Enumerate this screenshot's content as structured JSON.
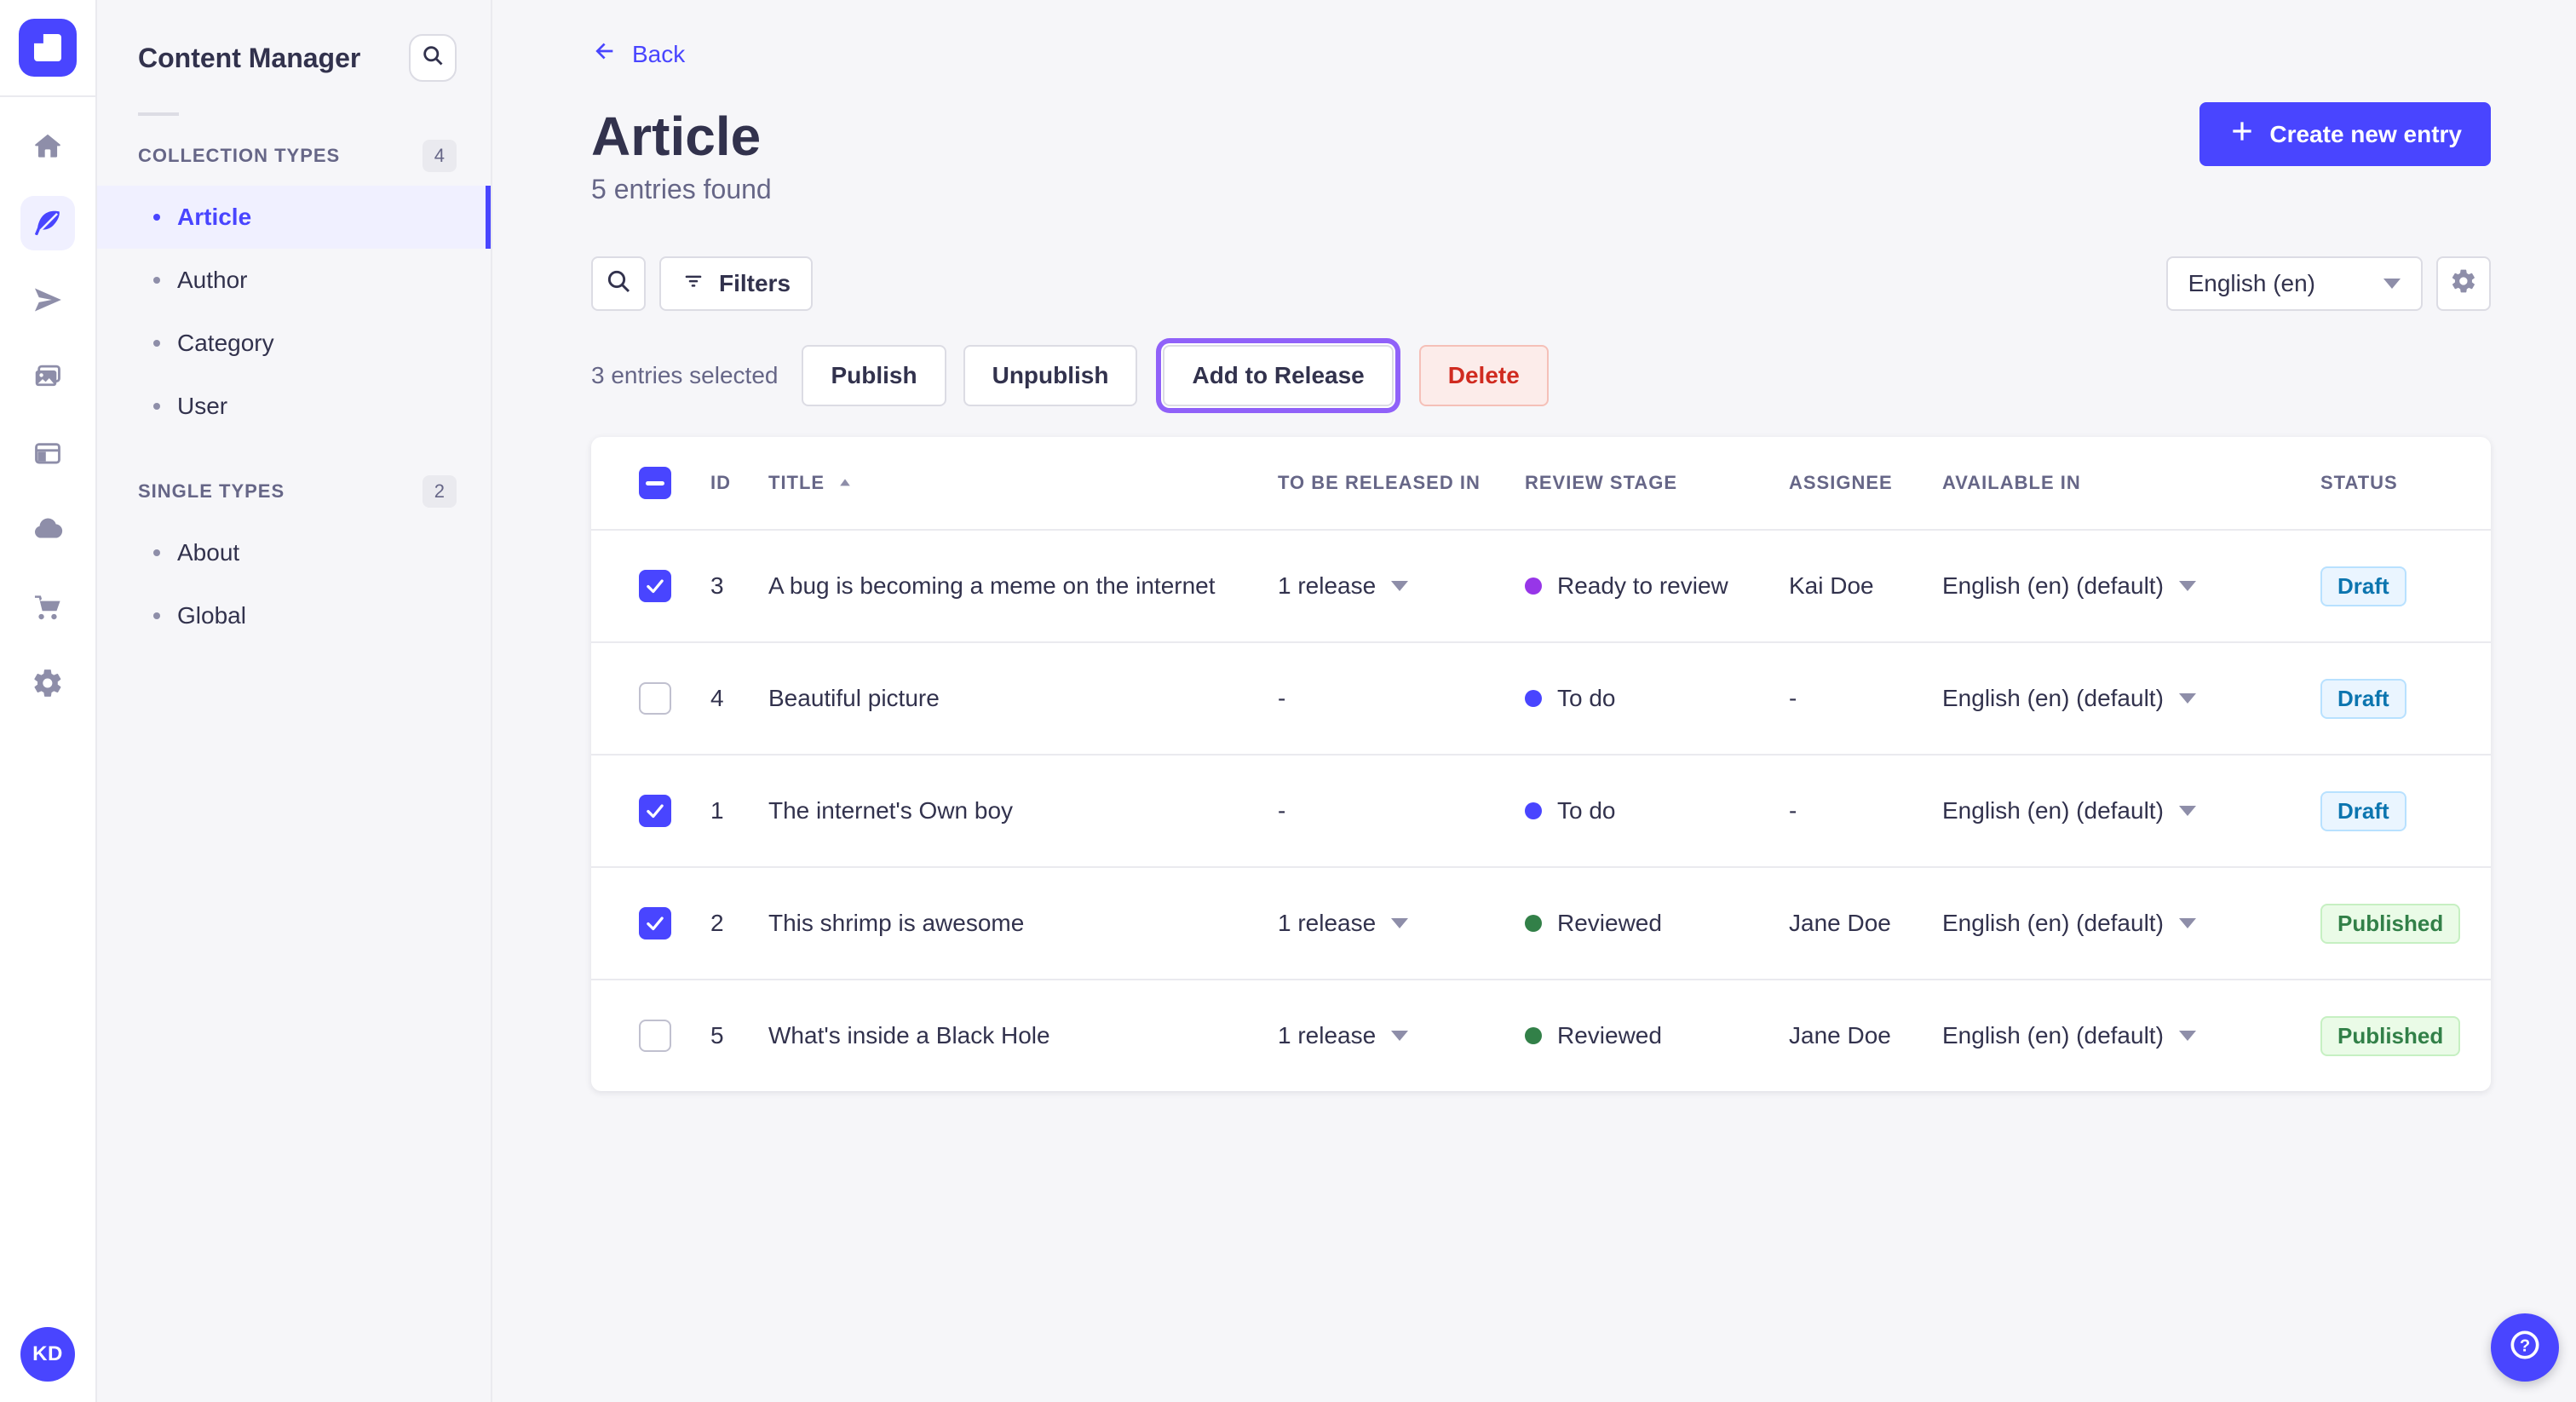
{
  "colors": {
    "primary": "#4945ff",
    "primary_light_bg": "#f0f0ff",
    "focus_ring": "#9061f9",
    "danger_text": "#d02b20",
    "danger_bg": "#fcecea",
    "danger_border": "#f5c0b8",
    "draft_bg": "#eaf5ff",
    "draft_border": "#b8e1ff",
    "draft_text": "#0c75af",
    "published_bg": "#eafbe7",
    "published_border": "#c6f0c2",
    "published_text": "#328048"
  },
  "rail": {
    "icons": [
      {
        "name": "home",
        "active": false
      },
      {
        "name": "content-manager",
        "active": true
      },
      {
        "name": "releases",
        "active": false
      },
      {
        "name": "media-library",
        "active": false
      },
      {
        "name": "content-type-builder",
        "active": false
      },
      {
        "name": "cloud",
        "active": false
      },
      {
        "name": "marketplace",
        "active": false
      },
      {
        "name": "settings",
        "active": false
      }
    ],
    "avatar_initials": "KD"
  },
  "sidebar": {
    "title": "Content Manager",
    "sections": [
      {
        "label": "COLLECTION TYPES",
        "count": "4",
        "items": [
          {
            "label": "Article",
            "active": true
          },
          {
            "label": "Author",
            "active": false
          },
          {
            "label": "Category",
            "active": false
          },
          {
            "label": "User",
            "active": false
          }
        ]
      },
      {
        "label": "SINGLE TYPES",
        "count": "2",
        "items": [
          {
            "label": "About",
            "active": false
          },
          {
            "label": "Global",
            "active": false
          }
        ]
      }
    ]
  },
  "header": {
    "back_label": "Back",
    "title": "Article",
    "subtitle": "5 entries found",
    "create_button": "Create new entry"
  },
  "toolbar": {
    "filters_label": "Filters",
    "locale_value": "English (en)"
  },
  "selection": {
    "summary": "3 entries selected",
    "publish_label": "Publish",
    "unpublish_label": "Unpublish",
    "add_to_release_label": "Add to Release",
    "delete_label": "Delete"
  },
  "table": {
    "columns": [
      "ID",
      "TITLE",
      "TO BE RELEASED IN",
      "REVIEW STAGE",
      "ASSIGNEE",
      "AVAILABLE IN",
      "STATUS"
    ],
    "sorted_column": "TITLE",
    "header_checkbox_state": "indeterminate",
    "rows": [
      {
        "checked": true,
        "id": "3",
        "title": "A bug is becoming a meme on the internet",
        "release": "1 release",
        "has_release_menu": true,
        "stage": "Ready to review",
        "stage_color": "#9736e8",
        "assignee": "Kai Doe",
        "available": "English (en) (default)",
        "status": "Draft",
        "status_kind": "draft"
      },
      {
        "checked": false,
        "id": "4",
        "title": "Beautiful picture",
        "release": "-",
        "has_release_menu": false,
        "stage": "To do",
        "stage_color": "#4945ff",
        "assignee": "-",
        "available": "English (en) (default)",
        "status": "Draft",
        "status_kind": "draft"
      },
      {
        "checked": true,
        "id": "1",
        "title": "The internet's Own boy",
        "release": "-",
        "has_release_menu": false,
        "stage": "To do",
        "stage_color": "#4945ff",
        "assignee": "-",
        "available": "English (en) (default)",
        "status": "Draft",
        "status_kind": "draft"
      },
      {
        "checked": true,
        "id": "2",
        "title": "This shrimp is awesome",
        "release": "1 release",
        "has_release_menu": true,
        "stage": "Reviewed",
        "stage_color": "#328048",
        "assignee": "Jane Doe",
        "available": "English (en) (default)",
        "status": "Published",
        "status_kind": "published"
      },
      {
        "checked": false,
        "id": "5",
        "title": "What's inside a Black Hole",
        "release": "1 release",
        "has_release_menu": true,
        "stage": "Reviewed",
        "stage_color": "#328048",
        "assignee": "Jane Doe",
        "available": "English (en) (default)",
        "status": "Published",
        "status_kind": "published"
      }
    ]
  },
  "help": {
    "label": "?"
  }
}
